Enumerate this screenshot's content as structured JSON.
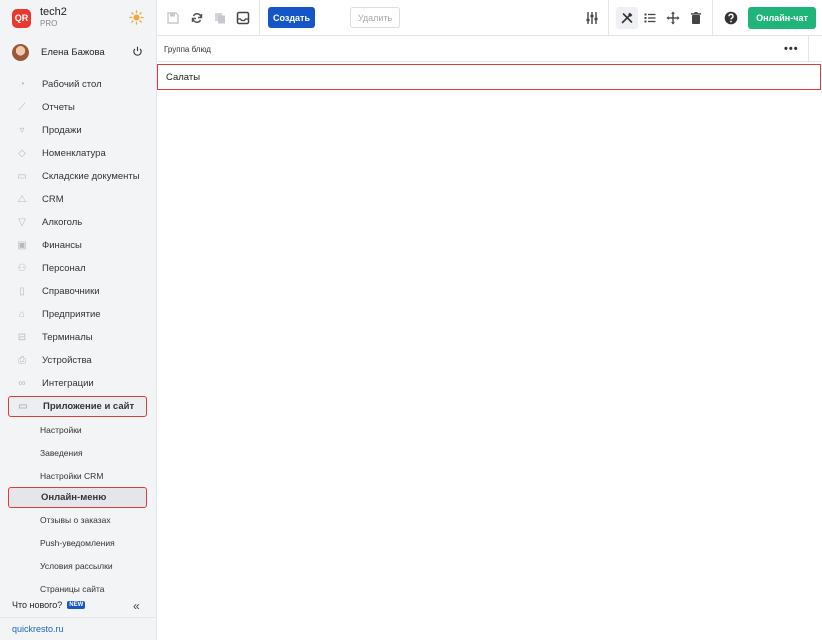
{
  "brand": {
    "name": "tech2",
    "plan": "PRO",
    "logo_text": "QR"
  },
  "user": {
    "name": "Елена Бажова"
  },
  "nav": [
    {
      "label": "Рабочий стол",
      "icon": "gauge-icon"
    },
    {
      "label": "Отчеты",
      "icon": "chart-icon"
    },
    {
      "label": "Продажи",
      "icon": "basket-icon"
    },
    {
      "label": "Номенклатура",
      "icon": "tag-icon"
    },
    {
      "label": "Складские документы",
      "icon": "box-icon"
    },
    {
      "label": "CRM",
      "icon": "people-icon"
    },
    {
      "label": "Алкоголь",
      "icon": "glass-icon"
    },
    {
      "label": "Финансы",
      "icon": "wallet-icon"
    },
    {
      "label": "Персонал",
      "icon": "staff-icon"
    },
    {
      "label": "Справочники",
      "icon": "book-icon"
    },
    {
      "label": "Предприятие",
      "icon": "store-icon"
    },
    {
      "label": "Терминалы",
      "icon": "terminal-icon"
    },
    {
      "label": "Устройства",
      "icon": "printer-icon"
    },
    {
      "label": "Интеграции",
      "icon": "link-icon"
    },
    {
      "label": "Приложение и сайт",
      "icon": "app-icon"
    }
  ],
  "subnav": [
    {
      "label": "Настройки"
    },
    {
      "label": "Заведения"
    },
    {
      "label": "Настройки CRM"
    },
    {
      "label": "Онлайн-меню"
    },
    {
      "label": "Отзывы о заказах"
    },
    {
      "label": "Push-уведомления"
    },
    {
      "label": "Условия рассылки"
    },
    {
      "label": "Страницы сайта"
    }
  ],
  "footer": {
    "whats_new": "Что нового?",
    "new_badge": "NEW",
    "collapse": "«",
    "site_link": "quickresto.ru"
  },
  "toolbar": {
    "create": "Создать",
    "delete": "Удалить",
    "chat": "Онлайн-чат"
  },
  "main": {
    "group_label": "Группа блюд",
    "more": "•••",
    "rows": [
      "Салаты"
    ]
  },
  "colors": {
    "primary": "#1456c8",
    "chat": "#1fb57a",
    "highlight": "#e03a3a",
    "logo": "#e8392f"
  }
}
